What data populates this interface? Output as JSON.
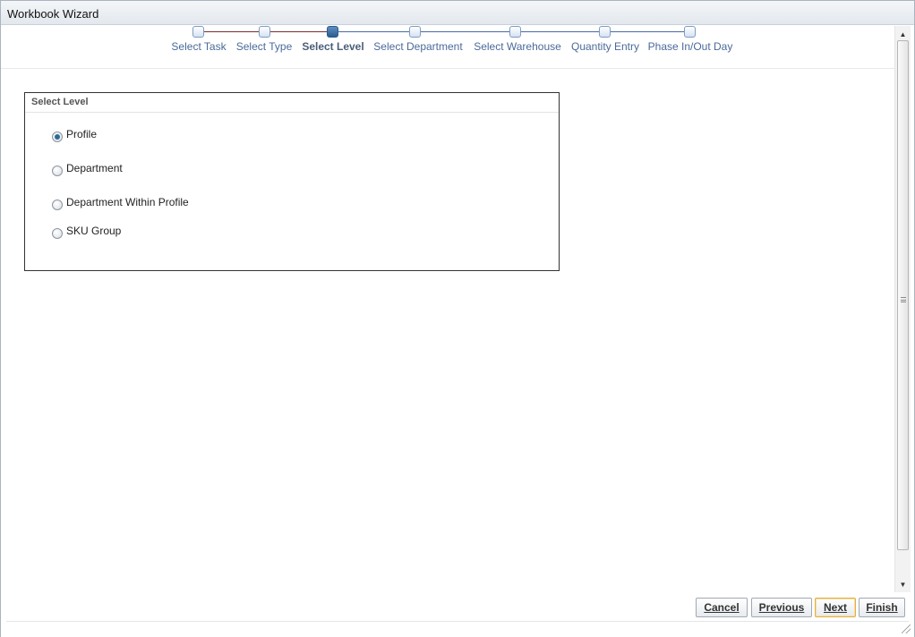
{
  "window": {
    "title": "Workbook Wizard"
  },
  "train": {
    "steps": [
      {
        "label": "Select Task",
        "state": "visited"
      },
      {
        "label": "Select Type",
        "state": "visited"
      },
      {
        "label": "Select Level",
        "state": "current"
      },
      {
        "label": "Select Department",
        "state": "unvisited"
      },
      {
        "label": "Select Warehouse",
        "state": "unvisited"
      },
      {
        "label": "Quantity Entry",
        "state": "unvisited"
      },
      {
        "label": "Phase In/Out Day",
        "state": "unvisited"
      }
    ]
  },
  "panel": {
    "header": "Select Level",
    "options": [
      {
        "label": "Profile",
        "checked": true
      },
      {
        "label": "Department",
        "checked": false
      },
      {
        "label": "Department Within Profile",
        "checked": false
      },
      {
        "label": "SKU Group",
        "checked": false
      }
    ]
  },
  "footer": {
    "cancel_label": "Cancel",
    "previous_label": "Previous",
    "next_label": "Next",
    "finish_label": "Finish"
  },
  "colors": {
    "current_step": "#2b5c8f",
    "link_text": "#4a6a9a",
    "default_button_border": "#e0b048"
  },
  "icons": {
    "scroll_up": "triangle-up-icon",
    "scroll_down": "triangle-down-icon",
    "resize": "resize-grip-icon"
  }
}
